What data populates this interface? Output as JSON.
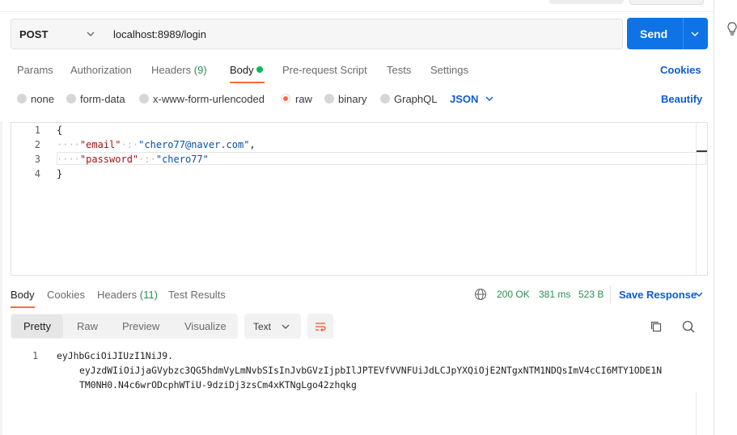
{
  "request": {
    "method": "POST",
    "url": "localhost:8989/login",
    "send_label": "Send"
  },
  "request_tabs": {
    "params": "Params",
    "authorization": "Authorization",
    "headers": "Headers",
    "headers_count": "(9)",
    "body": "Body",
    "pre_request": "Pre-request Script",
    "tests": "Tests",
    "settings": "Settings",
    "cookies": "Cookies"
  },
  "body_types": {
    "none": "none",
    "form_data": "form-data",
    "urlencoded": "x-www-form-urlencoded",
    "raw": "raw",
    "binary": "binary",
    "graphql": "GraphQL",
    "selected": "raw",
    "format": "JSON",
    "beautify": "Beautify"
  },
  "editor": {
    "line_numbers": [
      "1",
      "2",
      "3",
      "4"
    ],
    "open_brace": "{",
    "key1": "\"email\"",
    "val1": "\"chero77@naver.com\"",
    "key2": "\"password\"",
    "val2": "\"chero77\"",
    "close_brace": "}"
  },
  "response": {
    "tabs": {
      "body": "Body",
      "cookies": "Cookies",
      "headers": "Headers",
      "headers_count": "(11)",
      "test_results": "Test Results"
    },
    "status": "200 OK",
    "time": "381 ms",
    "size": "523 B",
    "save_label": "Save Response",
    "views": {
      "pretty": "Pretty",
      "raw": "Raw",
      "preview": "Preview",
      "visualize": "Visualize"
    },
    "format": "Text",
    "line_number": "1",
    "body_lines": [
      "eyJhbGciOiJIUzI1NiJ9.",
      "eyJzdWIiOiJjaGVybzc3QG5hdmVyLmNvbSIsInJvbGVzIjpbIlJPTEVfVVNFUiJdLCJpYXQiOjE2NTgxNTM1NDQsImV4cCI6MTY1ODE1N",
      "TM0NH0.N4c6wrODcphWTiU-9dziDj3zsCm4xKTNgLgo42zhqkg"
    ]
  },
  "colors": {
    "accent": "#ff6c37",
    "send": "#0f73e6",
    "link": "#0f5bd1",
    "success": "#2e8b57"
  },
  "icons": [
    "lightbulb-icon",
    "chevron-down-icon",
    "globe-icon",
    "wrap-icon",
    "copy-icon",
    "search-icon"
  ]
}
